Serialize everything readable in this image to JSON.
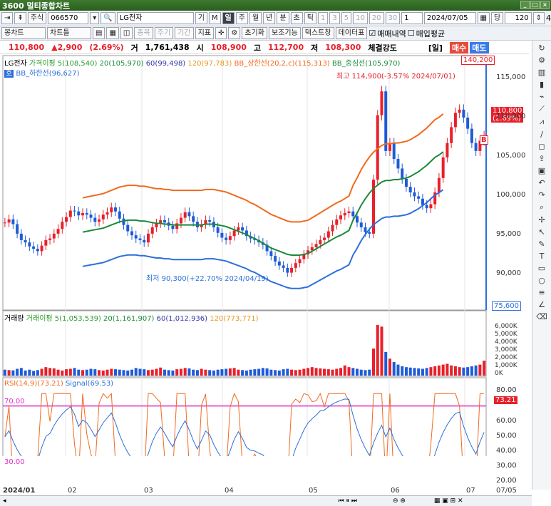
{
  "app": {
    "title": "3600 멀티종합차트"
  },
  "toolbar1": {
    "market": "주식",
    "code": "066570",
    "search_prefix": "관",
    "name": "LG전자",
    "periods": [
      "틱",
      "분",
      "일",
      "주",
      "월",
      "년",
      "분",
      "초",
      "틱"
    ],
    "selected": "일",
    "nums": [
      "1",
      "3",
      "5",
      "10",
      "20",
      "30"
    ],
    "count_sel": "1",
    "date": "2024/07/05",
    "dang": "당",
    "qty": "120",
    "page": "4"
  },
  "toolbar2": {
    "chart_type": "봉차트",
    "chart_type2": "차트틀",
    "buttons": [
      "종목",
      "주기",
      "기간",
      "지표"
    ],
    "reset": "초기화",
    "aux": "보조기능",
    "text": "텍스트창",
    "datatable": "데이터표",
    "check1": "매매내역",
    "check2": "매입평균"
  },
  "quote": {
    "price": "110,800",
    "change": "▲2,900",
    "pct": "(2.69%)",
    "vol_label": "거",
    "volume": "1,761,438",
    "open_label": "시",
    "open": "108,900",
    "high_label": "고",
    "high": "112,700",
    "low_label": "저",
    "low": "108,300",
    "strength_label": "체결강도",
    "period": "[일]",
    "buy": "매수",
    "sell": "매도"
  },
  "price_legend": {
    "name": "LG전자",
    "ma5": "가격이평 5(108,540)",
    "ma20": "20(105,970)",
    "ma60": "60(99,498)",
    "ma120": "120(97,783)",
    "bb_up": "BB_상한선(20,2,c)(115,313)",
    "bb_mid": "BB_중심선(105,970)",
    "bb_low": "BB_하한선(96,627)",
    "box_tag": "호"
  },
  "annotations": {
    "high": "최고 114,900(-3.57% 2024/07/01)",
    "low": "최저 90,300(+22.70% 2024/04/19)",
    "top_box": "140,200",
    "bottom_box": "75,600",
    "cur": "110,800",
    "cur_pct": "(2.69%)",
    "b_mark": "B"
  },
  "price_axis": [
    "115,000",
    "110,000",
    "105,000",
    "100,000",
    "95,000",
    "90,000"
  ],
  "vol_legend": {
    "label": "거래량",
    "ma5": "거래이평 5(1,053,539)",
    "ma20": "20(1,161,907)",
    "ma60": "60(1,012,936)",
    "ma120": "120(773,771)"
  },
  "vol_axis": [
    "6,000K",
    "5,000K",
    "4,000K",
    "3,000K",
    "2,000K",
    "1,000K",
    "0K"
  ],
  "rsi_legend": {
    "rsi": "RSI(14,9)(73.21)",
    "signal": "Signal(69.53)",
    "lvl70": "70.00",
    "lvl30": "30.00",
    "cur": "73.21"
  },
  "rsi_axis": [
    "80.00",
    "70.00",
    "60.00",
    "50.00",
    "40.00",
    "30.00",
    "20.00"
  ],
  "x_axis": [
    "2024/01",
    "02",
    "03",
    "04",
    "05",
    "06",
    "07",
    "07/05"
  ],
  "colors": {
    "up": "#e8202a",
    "down": "#1f5bd8",
    "ma5": "#2e9c2e",
    "ma20": "#1a8a3a",
    "ma60": "#3535a8",
    "ma120": "#e8951f",
    "bb_up": "#f06a1f",
    "bb_low": "#2c6fdb",
    "rsi": "#f06a1f",
    "signal": "#2c6fdb",
    "hl": "#e030c8"
  },
  "chart_data": {
    "type": "candlestick",
    "ylim": [
      86000,
      118000
    ],
    "close": [
      97000,
      97400,
      96800,
      95600,
      94800,
      94500,
      94000,
      93700,
      93400,
      94100,
      94800,
      95000,
      95600,
      96200,
      97100,
      97700,
      98500,
      98400,
      97900,
      98200,
      98000,
      97600,
      97100,
      97400,
      98000,
      98300,
      98900,
      98400,
      97500,
      96700,
      95900,
      95400,
      95000,
      94800,
      94500,
      95600,
      96400,
      96900,
      97300,
      97000,
      96600,
      96200,
      96900,
      97600,
      98300,
      97800,
      97100,
      96400,
      96800,
      97300,
      97100,
      96400,
      95700,
      95100,
      94800,
      95300,
      96000,
      96400,
      96000,
      95300,
      95000,
      94800,
      94500,
      94200,
      93400,
      92800,
      92100,
      91600,
      91300,
      90700,
      91300,
      91900,
      92400,
      93000,
      93500,
      93900,
      94300,
      94800,
      95100,
      95900,
      96700,
      97400,
      97900,
      98200,
      98400,
      97800,
      97000,
      96400,
      95800,
      95600,
      102400,
      110500,
      113500,
      106000,
      107000,
      105000,
      103800,
      102500,
      101500,
      100800,
      100300,
      100000,
      99200,
      98800,
      99300,
      100800,
      102600,
      105200,
      107000,
      109000,
      110800,
      111200,
      110200,
      108800,
      107000,
      106000,
      107300,
      107900
    ],
    "ma20": [
      null,
      null,
      null,
      null,
      null,
      null,
      null,
      null,
      null,
      null,
      null,
      null,
      null,
      null,
      null,
      null,
      null,
      null,
      null,
      95800,
      95900,
      96000,
      96100,
      96200,
      96300,
      96500,
      96700,
      96900,
      97100,
      97200,
      97300,
      97300,
      97300,
      97200,
      97200,
      97100,
      97000,
      96900,
      96900,
      96800,
      96800,
      96700,
      96700,
      96700,
      96700,
      96700,
      96700,
      96700,
      96700,
      96800,
      96800,
      96800,
      96700,
      96600,
      96500,
      96300,
      96100,
      95900,
      95700,
      95500,
      95200,
      95000,
      94700,
      94400,
      94100,
      93800,
      93600,
      93400,
      93200,
      93000,
      92900,
      92900,
      92900,
      93000,
      93100,
      93400,
      93700,
      94000,
      94300,
      94600,
      94900,
      95200,
      95400,
      95700,
      96000,
      97300,
      98200,
      99200,
      100000,
      100700,
      101300,
      101700,
      102100,
      102300,
      102300,
      102400,
      102400,
      102500,
      102600,
      102800,
      103100,
      103400,
      103800,
      104200,
      104700,
      105200,
      105500,
      105900
    ],
    "vol": [
      700,
      650,
      620,
      800,
      900,
      600,
      700,
      550,
      650,
      800,
      1000,
      900,
      850,
      700,
      600,
      750,
      800,
      900,
      700,
      650,
      700,
      800,
      750,
      650,
      600,
      700,
      800,
      750,
      700,
      650,
      600,
      700,
      900,
      800,
      750,
      650,
      700,
      800,
      950,
      700,
      650,
      600,
      750,
      800,
      900,
      850,
      700,
      650,
      800,
      700,
      650,
      600,
      700,
      750,
      800,
      850,
      900,
      700,
      650,
      600,
      700,
      750,
      800,
      900,
      850,
      700,
      650,
      600,
      750,
      800,
      700,
      650,
      700,
      800,
      900,
      1000,
      900,
      850,
      800,
      750,
      700,
      800,
      900,
      1200,
      1000,
      900,
      800,
      700,
      650,
      700,
      3200,
      6000,
      5800,
      2800,
      2000,
      1600,
      1300,
      1100,
      1000,
      950,
      900,
      850,
      800,
      900,
      1000,
      1100,
      1200,
      1300,
      1400,
      1200,
      1100,
      1000,
      950,
      1000,
      1100,
      1200,
      1300,
      1761
    ]
  }
}
